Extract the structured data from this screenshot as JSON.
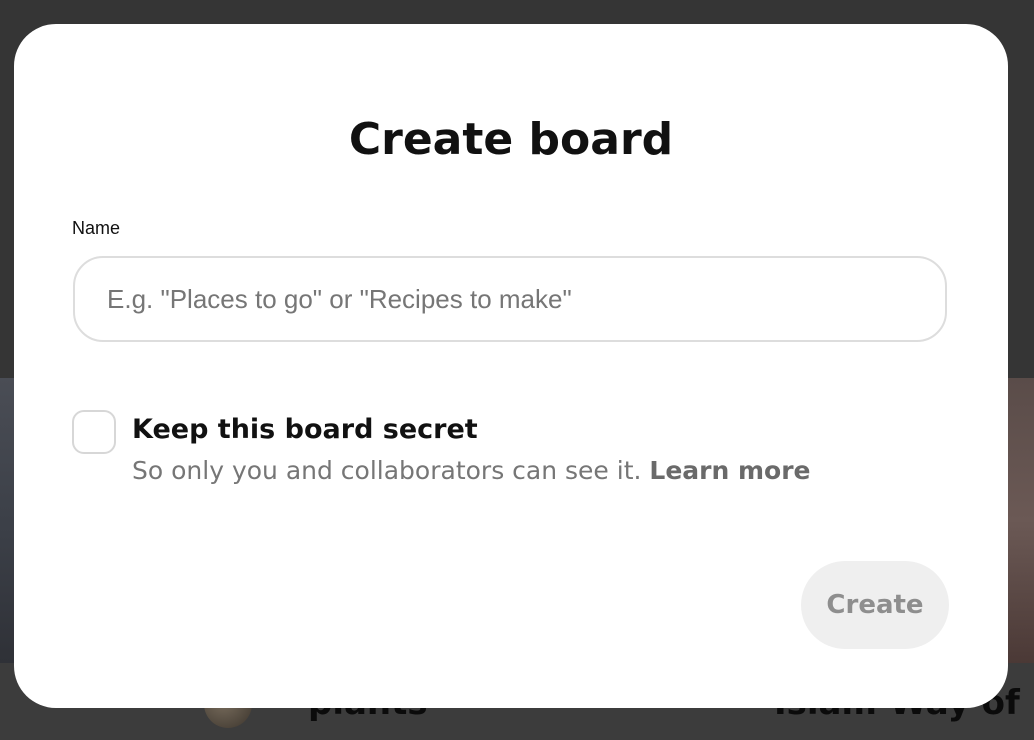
{
  "modal": {
    "title": "Create board",
    "name_field": {
      "label": "Name",
      "value": "",
      "placeholder": "E.g. \"Places to go\" or \"Recipes to make\""
    },
    "secret_option": {
      "checked": false,
      "label": "Keep this board secret",
      "description": "So only you and collaborators can see it.",
      "learn_more_link": "Learn more"
    },
    "create_button": {
      "label": "Create",
      "enabled": false
    }
  },
  "background": {
    "left_card_title": "plants",
    "right_card_title": "Islam-Way of li"
  },
  "colors": {
    "overlay": "#353535",
    "modal_background": "#ffffff",
    "text_primary": "#111111",
    "text_secondary": "#767676",
    "input_border": "#dddddd",
    "button_disabled_bg": "#efefef",
    "button_disabled_text": "#8e8e8e"
  }
}
